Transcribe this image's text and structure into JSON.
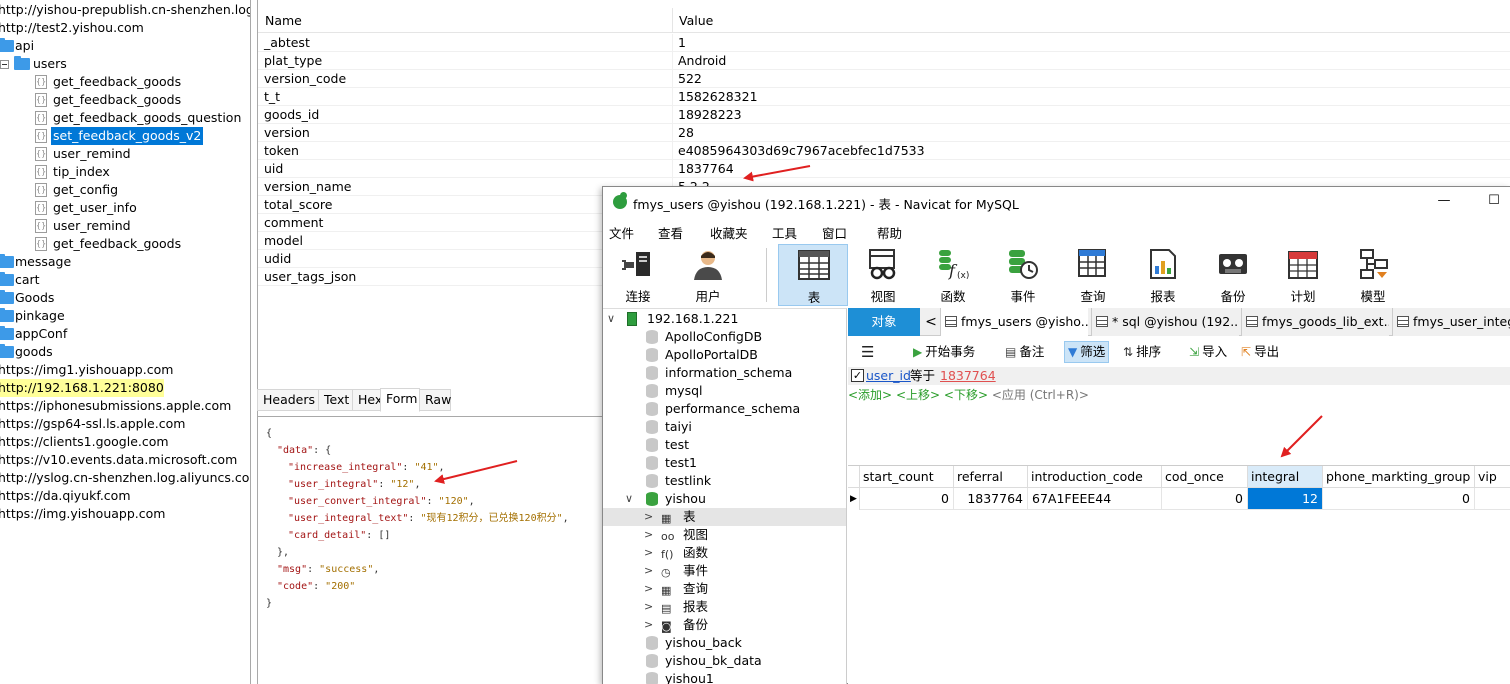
{
  "left_tree": {
    "rows": [
      {
        "label": "http://yishou-prepublish.cn-shenzhen.log.aliyuncs.com",
        "indent": 0,
        "kind": "host"
      },
      {
        "label": "http://test2.yishou.com",
        "indent": 0,
        "kind": "host"
      },
      {
        "label": "api",
        "indent": 1,
        "kind": "folder",
        "expander": "minus"
      },
      {
        "label": "users",
        "indent": 2,
        "kind": "folder",
        "expander": "minus"
      },
      {
        "label": "get_feedback_goods",
        "indent": 3,
        "kind": "file"
      },
      {
        "label": "get_feedback_goods",
        "indent": 3,
        "kind": "file"
      },
      {
        "label": "get_feedback_goods_question",
        "indent": 3,
        "kind": "file"
      },
      {
        "label": "set_feedback_goods_v2",
        "indent": 3,
        "kind": "file",
        "selected": true
      },
      {
        "label": "user_remind",
        "indent": 3,
        "kind": "file"
      },
      {
        "label": "tip_index",
        "indent": 3,
        "kind": "file"
      },
      {
        "label": "get_config",
        "indent": 3,
        "kind": "file"
      },
      {
        "label": "get_user_info",
        "indent": 3,
        "kind": "file"
      },
      {
        "label": "user_remind",
        "indent": 3,
        "kind": "file"
      },
      {
        "label": "get_feedback_goods",
        "indent": 3,
        "kind": "file"
      },
      {
        "label": "message",
        "indent": 1,
        "kind": "folder",
        "expander": "plus"
      },
      {
        "label": "cart",
        "indent": 1,
        "kind": "folder",
        "expander": "plus"
      },
      {
        "label": "Goods",
        "indent": 1,
        "kind": "folder",
        "expander": "plus"
      },
      {
        "label": "pinkage",
        "indent": 1,
        "kind": "folder",
        "expander": "plus"
      },
      {
        "label": "appConf",
        "indent": 1,
        "kind": "folder",
        "expander": "plus"
      },
      {
        "label": "goods",
        "indent": 1,
        "kind": "folder",
        "expander": "plus"
      },
      {
        "label": "https://img1.yishouapp.com",
        "indent": 0,
        "kind": "host"
      },
      {
        "label": "http://192.168.1.221:8080",
        "indent": 0,
        "kind": "host",
        "highlighted": true
      },
      {
        "label": "https://iphonesubmissions.apple.com",
        "indent": 0,
        "kind": "host"
      },
      {
        "label": "https://gsp64-ssl.ls.apple.com",
        "indent": 0,
        "kind": "host"
      },
      {
        "label": "https://clients1.google.com",
        "indent": 0,
        "kind": "host"
      },
      {
        "label": "https://v10.events.data.microsoft.com",
        "indent": 0,
        "kind": "host"
      },
      {
        "label": "http://yslog.cn-shenzhen.log.aliyuncs.com",
        "indent": 0,
        "kind": "host"
      },
      {
        "label": "https://da.qiyukf.com",
        "indent": 0,
        "kind": "host"
      },
      {
        "label": "https://img.yishouapp.com",
        "indent": 0,
        "kind": "host"
      }
    ]
  },
  "request": {
    "header_name": "Name",
    "header_value": "Value",
    "params": [
      {
        "name": "_abtest",
        "value": "1"
      },
      {
        "name": "plat_type",
        "value": "Android"
      },
      {
        "name": "version_code",
        "value": "522"
      },
      {
        "name": "t_t",
        "value": "1582628321"
      },
      {
        "name": "goods_id",
        "value": "18928223"
      },
      {
        "name": "version",
        "value": "28"
      },
      {
        "name": "token",
        "value": "e4085964303d69c7967acebfec1d7533"
      },
      {
        "name": "uid",
        "value": "1837764"
      },
      {
        "name": "version_name",
        "value": "5.2.2"
      },
      {
        "name": "total_score",
        "value": ""
      },
      {
        "name": "comment",
        "value": ""
      },
      {
        "name": "model",
        "value": ""
      },
      {
        "name": "udid",
        "value": ""
      },
      {
        "name": "user_tags_json",
        "value": ""
      }
    ],
    "tabs": [
      "Headers",
      "Text",
      "Hex",
      "Form",
      "Raw"
    ],
    "active_tab": "Form"
  },
  "response_json": {
    "lines": [
      {
        "indent": 0,
        "parts": [
          {
            "t": "{",
            "c": "p"
          }
        ]
      },
      {
        "indent": 1,
        "parts": [
          {
            "t": "\"data\"",
            "c": "k"
          },
          {
            "t": ": {",
            "c": "p"
          }
        ]
      },
      {
        "indent": 2,
        "parts": [
          {
            "t": "\"increase_integral\"",
            "c": "k"
          },
          {
            "t": ": ",
            "c": "p"
          },
          {
            "t": "\"41\"",
            "c": "s"
          },
          {
            "t": ",",
            "c": "p"
          }
        ]
      },
      {
        "indent": 2,
        "parts": [
          {
            "t": "\"user_integral\"",
            "c": "k"
          },
          {
            "t": ": ",
            "c": "p"
          },
          {
            "t": "\"12\"",
            "c": "s"
          },
          {
            "t": ",",
            "c": "p"
          }
        ]
      },
      {
        "indent": 2,
        "parts": [
          {
            "t": "\"user_convert_integral\"",
            "c": "k"
          },
          {
            "t": ": ",
            "c": "p"
          },
          {
            "t": "\"120\"",
            "c": "s"
          },
          {
            "t": ",",
            "c": "p"
          }
        ]
      },
      {
        "indent": 2,
        "parts": [
          {
            "t": "\"user_integral_text\"",
            "c": "k"
          },
          {
            "t": ": ",
            "c": "p"
          },
          {
            "t": "\"现有12积分，已兑换120积分\"",
            "c": "s"
          },
          {
            "t": ",",
            "c": "p"
          }
        ]
      },
      {
        "indent": 2,
        "parts": [
          {
            "t": "\"card_detail\"",
            "c": "k"
          },
          {
            "t": ": []",
            "c": "p"
          }
        ]
      },
      {
        "indent": 1,
        "parts": [
          {
            "t": "},",
            "c": "p"
          }
        ]
      },
      {
        "indent": 1,
        "parts": [
          {
            "t": "\"msg\"",
            "c": "k"
          },
          {
            "t": ": ",
            "c": "p"
          },
          {
            "t": "\"success\"",
            "c": "s"
          },
          {
            "t": ",",
            "c": "p"
          }
        ]
      },
      {
        "indent": 1,
        "parts": [
          {
            "t": "\"code\"",
            "c": "k"
          },
          {
            "t": ": ",
            "c": "p"
          },
          {
            "t": "\"200\"",
            "c": "s"
          }
        ]
      },
      {
        "indent": 0,
        "parts": [
          {
            "t": "}",
            "c": "p"
          }
        ]
      }
    ]
  },
  "navicat": {
    "title": "fmys_users @yishou (192.168.1.221) - 表 - Navicat for MySQL",
    "window_buttons": {
      "minimize": "—",
      "maximize": "☐"
    },
    "menu": [
      "文件",
      "查看",
      "收藏夹",
      "工具",
      "窗口",
      "帮助"
    ],
    "toolbar": [
      {
        "label": "连接",
        "icon": "plug-icon"
      },
      {
        "label": "用户",
        "icon": "user-icon"
      },
      {
        "label": "表",
        "icon": "table-icon",
        "active": true
      },
      {
        "label": "视图",
        "icon": "view-icon"
      },
      {
        "label": "函数",
        "icon": "function-icon"
      },
      {
        "label": "事件",
        "icon": "event-icon"
      },
      {
        "label": "查询",
        "icon": "query-icon"
      },
      {
        "label": "报表",
        "icon": "report-icon"
      },
      {
        "label": "备份",
        "icon": "backup-icon"
      },
      {
        "label": "计划",
        "icon": "schedule-icon"
      },
      {
        "label": "模型",
        "icon": "model-icon"
      }
    ],
    "tree": [
      {
        "label": "192.168.1.221",
        "kind": "server",
        "chevron": "v",
        "indent": 0
      },
      {
        "label": "ApolloConfigDB",
        "kind": "db",
        "indent": 1
      },
      {
        "label": "ApolloPortalDB",
        "kind": "db",
        "indent": 1
      },
      {
        "label": "information_schema",
        "kind": "db",
        "indent": 1
      },
      {
        "label": "mysql",
        "kind": "db",
        "indent": 1
      },
      {
        "label": "performance_schema",
        "kind": "db",
        "indent": 1
      },
      {
        "label": "taiyi",
        "kind": "db",
        "indent": 1
      },
      {
        "label": "test",
        "kind": "db",
        "indent": 1
      },
      {
        "label": "test1",
        "kind": "db",
        "indent": 1
      },
      {
        "label": "testlink",
        "kind": "db",
        "indent": 1
      },
      {
        "label": "yishou",
        "kind": "db-open",
        "chevron": "v",
        "indent": 1
      },
      {
        "label": "表",
        "kind": "sub",
        "icon": "▦",
        "chevron": ">",
        "indent": 2,
        "selected": true
      },
      {
        "label": "视图",
        "kind": "sub",
        "icon": "oo",
        "chevron": ">",
        "indent": 2
      },
      {
        "label": "函数",
        "kind": "sub",
        "icon": "f()",
        "chevron": ">",
        "indent": 2
      },
      {
        "label": "事件",
        "kind": "sub",
        "icon": "◷",
        "chevron": ">",
        "indent": 2
      },
      {
        "label": "查询",
        "kind": "sub",
        "icon": "▦",
        "chevron": ">",
        "indent": 2
      },
      {
        "label": "报表",
        "kind": "sub",
        "icon": "▤",
        "chevron": ">",
        "indent": 2
      },
      {
        "label": "备份",
        "kind": "sub",
        "icon": "◙",
        "chevron": ">",
        "indent": 2
      },
      {
        "label": "yishou_back",
        "kind": "db",
        "indent": 1
      },
      {
        "label": "yishou_bk_data",
        "kind": "db",
        "indent": 1
      },
      {
        "label": "yishou1",
        "kind": "db",
        "indent": 1
      }
    ],
    "object_tabs": {
      "objects": "对象",
      "nav_left": "<",
      "tabs": [
        "fmys_users @yisho...",
        "* sql @yishou (192....",
        "fmys_goods_lib_ext...",
        "fmys_user_integra"
      ]
    },
    "actions": [
      {
        "label": "",
        "icon": "menu-icon"
      },
      {
        "label": "开始事务",
        "icon": "transaction-icon"
      },
      {
        "label": "备注",
        "icon": "note-icon"
      },
      {
        "label": "筛选",
        "icon": "filter-icon",
        "active": true
      },
      {
        "label": "排序",
        "icon": "sort-icon"
      },
      {
        "label": "导入",
        "icon": "import-icon"
      },
      {
        "label": "导出",
        "icon": "export-icon"
      }
    ],
    "filter": {
      "checked": "✓",
      "field": "user_id",
      "op": "等于",
      "value": "1837764"
    },
    "hint": {
      "add": "<添加>",
      "up": "<上移>",
      "down": "<下移>",
      "apply": "<应用 (Ctrl+R)>"
    },
    "grid": {
      "columns": [
        "start_count",
        "referral",
        "introduction_code",
        "cod_once",
        "integral",
        "phone_markting_group",
        "vip"
      ],
      "row": [
        "0",
        "1837764",
        "67A1FEEE44",
        "0",
        "12",
        "0",
        ""
      ],
      "selected_col": 4,
      "row_marker": "▶"
    }
  },
  "colors": {
    "accent": "#0078d7",
    "arrow": "#e02020",
    "objects_tab": "#1e8fd6"
  }
}
